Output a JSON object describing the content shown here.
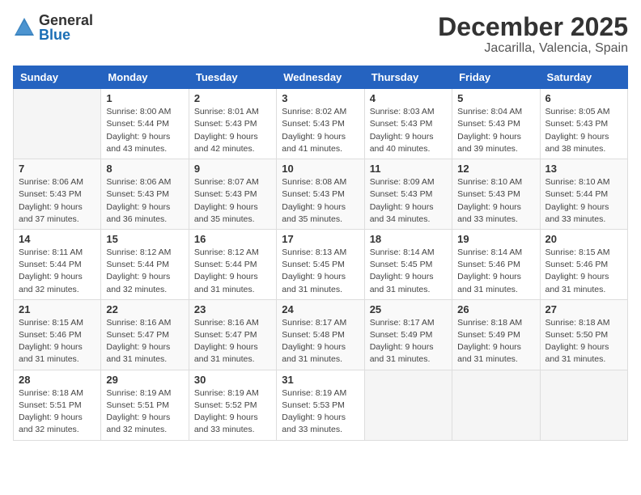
{
  "header": {
    "logo_general": "General",
    "logo_blue": "Blue",
    "month": "December 2025",
    "location": "Jacarilla, Valencia, Spain"
  },
  "days_of_week": [
    "Sunday",
    "Monday",
    "Tuesday",
    "Wednesday",
    "Thursday",
    "Friday",
    "Saturday"
  ],
  "weeks": [
    [
      {
        "day": "",
        "sunrise": "",
        "sunset": "",
        "daylight": ""
      },
      {
        "day": "1",
        "sunrise": "Sunrise: 8:00 AM",
        "sunset": "Sunset: 5:44 PM",
        "daylight": "Daylight: 9 hours and 43 minutes."
      },
      {
        "day": "2",
        "sunrise": "Sunrise: 8:01 AM",
        "sunset": "Sunset: 5:43 PM",
        "daylight": "Daylight: 9 hours and 42 minutes."
      },
      {
        "day": "3",
        "sunrise": "Sunrise: 8:02 AM",
        "sunset": "Sunset: 5:43 PM",
        "daylight": "Daylight: 9 hours and 41 minutes."
      },
      {
        "day": "4",
        "sunrise": "Sunrise: 8:03 AM",
        "sunset": "Sunset: 5:43 PM",
        "daylight": "Daylight: 9 hours and 40 minutes."
      },
      {
        "day": "5",
        "sunrise": "Sunrise: 8:04 AM",
        "sunset": "Sunset: 5:43 PM",
        "daylight": "Daylight: 9 hours and 39 minutes."
      },
      {
        "day": "6",
        "sunrise": "Sunrise: 8:05 AM",
        "sunset": "Sunset: 5:43 PM",
        "daylight": "Daylight: 9 hours and 38 minutes."
      }
    ],
    [
      {
        "day": "7",
        "sunrise": "Sunrise: 8:06 AM",
        "sunset": "Sunset: 5:43 PM",
        "daylight": "Daylight: 9 hours and 37 minutes."
      },
      {
        "day": "8",
        "sunrise": "Sunrise: 8:06 AM",
        "sunset": "Sunset: 5:43 PM",
        "daylight": "Daylight: 9 hours and 36 minutes."
      },
      {
        "day": "9",
        "sunrise": "Sunrise: 8:07 AM",
        "sunset": "Sunset: 5:43 PM",
        "daylight": "Daylight: 9 hours and 35 minutes."
      },
      {
        "day": "10",
        "sunrise": "Sunrise: 8:08 AM",
        "sunset": "Sunset: 5:43 PM",
        "daylight": "Daylight: 9 hours and 35 minutes."
      },
      {
        "day": "11",
        "sunrise": "Sunrise: 8:09 AM",
        "sunset": "Sunset: 5:43 PM",
        "daylight": "Daylight: 9 hours and 34 minutes."
      },
      {
        "day": "12",
        "sunrise": "Sunrise: 8:10 AM",
        "sunset": "Sunset: 5:43 PM",
        "daylight": "Daylight: 9 hours and 33 minutes."
      },
      {
        "day": "13",
        "sunrise": "Sunrise: 8:10 AM",
        "sunset": "Sunset: 5:44 PM",
        "daylight": "Daylight: 9 hours and 33 minutes."
      }
    ],
    [
      {
        "day": "14",
        "sunrise": "Sunrise: 8:11 AM",
        "sunset": "Sunset: 5:44 PM",
        "daylight": "Daylight: 9 hours and 32 minutes."
      },
      {
        "day": "15",
        "sunrise": "Sunrise: 8:12 AM",
        "sunset": "Sunset: 5:44 PM",
        "daylight": "Daylight: 9 hours and 32 minutes."
      },
      {
        "day": "16",
        "sunrise": "Sunrise: 8:12 AM",
        "sunset": "Sunset: 5:44 PM",
        "daylight": "Daylight: 9 hours and 31 minutes."
      },
      {
        "day": "17",
        "sunrise": "Sunrise: 8:13 AM",
        "sunset": "Sunset: 5:45 PM",
        "daylight": "Daylight: 9 hours and 31 minutes."
      },
      {
        "day": "18",
        "sunrise": "Sunrise: 8:14 AM",
        "sunset": "Sunset: 5:45 PM",
        "daylight": "Daylight: 9 hours and 31 minutes."
      },
      {
        "day": "19",
        "sunrise": "Sunrise: 8:14 AM",
        "sunset": "Sunset: 5:46 PM",
        "daylight": "Daylight: 9 hours and 31 minutes."
      },
      {
        "day": "20",
        "sunrise": "Sunrise: 8:15 AM",
        "sunset": "Sunset: 5:46 PM",
        "daylight": "Daylight: 9 hours and 31 minutes."
      }
    ],
    [
      {
        "day": "21",
        "sunrise": "Sunrise: 8:15 AM",
        "sunset": "Sunset: 5:46 PM",
        "daylight": "Daylight: 9 hours and 31 minutes."
      },
      {
        "day": "22",
        "sunrise": "Sunrise: 8:16 AM",
        "sunset": "Sunset: 5:47 PM",
        "daylight": "Daylight: 9 hours and 31 minutes."
      },
      {
        "day": "23",
        "sunrise": "Sunrise: 8:16 AM",
        "sunset": "Sunset: 5:47 PM",
        "daylight": "Daylight: 9 hours and 31 minutes."
      },
      {
        "day": "24",
        "sunrise": "Sunrise: 8:17 AM",
        "sunset": "Sunset: 5:48 PM",
        "daylight": "Daylight: 9 hours and 31 minutes."
      },
      {
        "day": "25",
        "sunrise": "Sunrise: 8:17 AM",
        "sunset": "Sunset: 5:49 PM",
        "daylight": "Daylight: 9 hours and 31 minutes."
      },
      {
        "day": "26",
        "sunrise": "Sunrise: 8:18 AM",
        "sunset": "Sunset: 5:49 PM",
        "daylight": "Daylight: 9 hours and 31 minutes."
      },
      {
        "day": "27",
        "sunrise": "Sunrise: 8:18 AM",
        "sunset": "Sunset: 5:50 PM",
        "daylight": "Daylight: 9 hours and 31 minutes."
      }
    ],
    [
      {
        "day": "28",
        "sunrise": "Sunrise: 8:18 AM",
        "sunset": "Sunset: 5:51 PM",
        "daylight": "Daylight: 9 hours and 32 minutes."
      },
      {
        "day": "29",
        "sunrise": "Sunrise: 8:19 AM",
        "sunset": "Sunset: 5:51 PM",
        "daylight": "Daylight: 9 hours and 32 minutes."
      },
      {
        "day": "30",
        "sunrise": "Sunrise: 8:19 AM",
        "sunset": "Sunset: 5:52 PM",
        "daylight": "Daylight: 9 hours and 33 minutes."
      },
      {
        "day": "31",
        "sunrise": "Sunrise: 8:19 AM",
        "sunset": "Sunset: 5:53 PM",
        "daylight": "Daylight: 9 hours and 33 minutes."
      },
      {
        "day": "",
        "sunrise": "",
        "sunset": "",
        "daylight": ""
      },
      {
        "day": "",
        "sunrise": "",
        "sunset": "",
        "daylight": ""
      },
      {
        "day": "",
        "sunrise": "",
        "sunset": "",
        "daylight": ""
      }
    ]
  ]
}
